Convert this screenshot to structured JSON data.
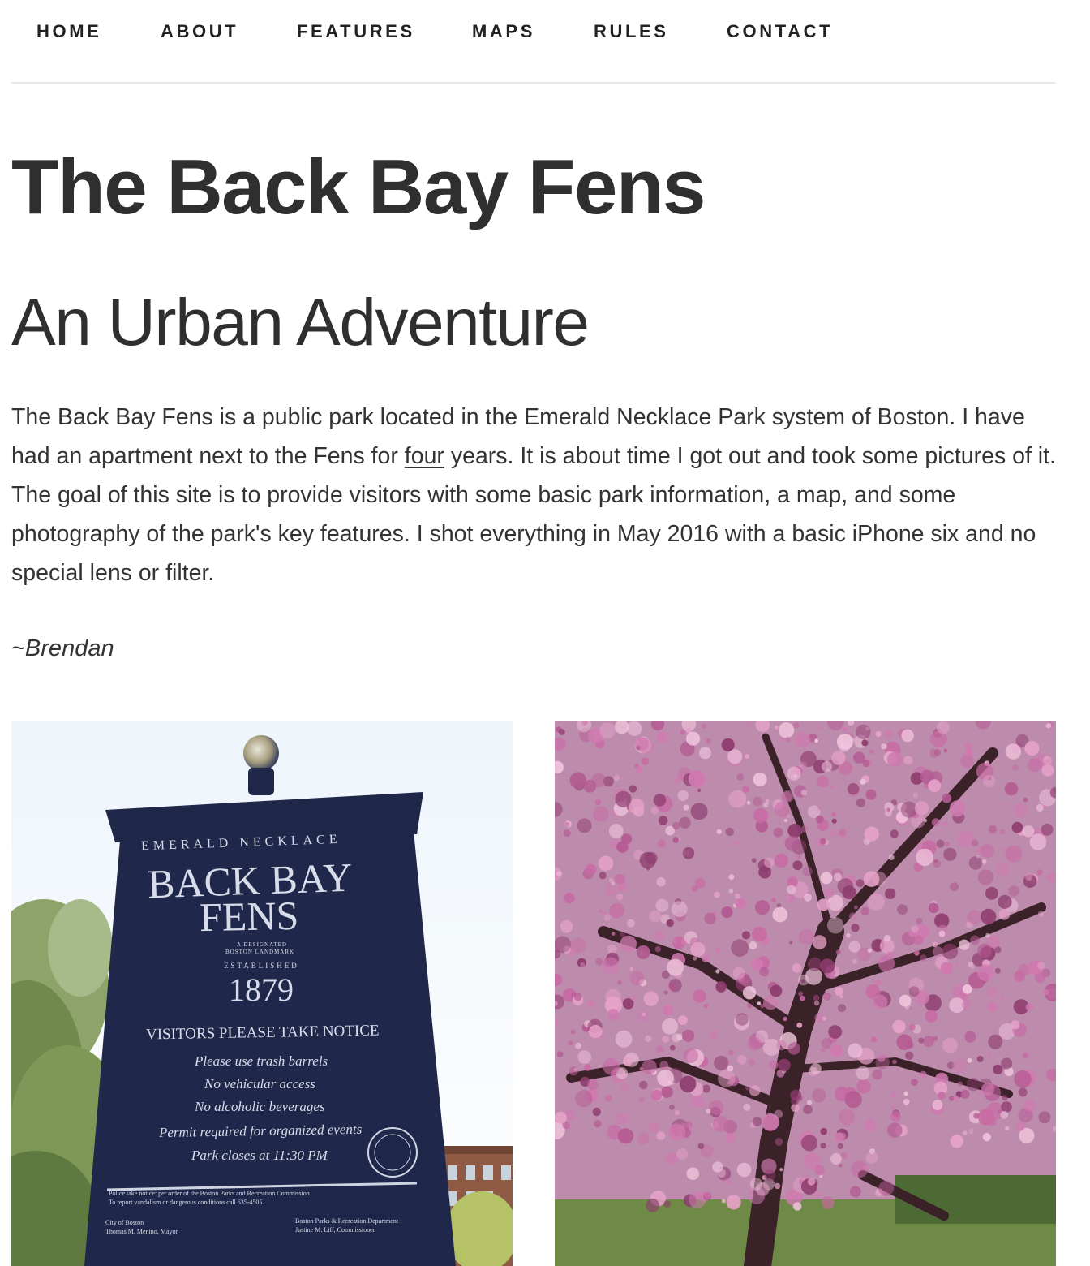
{
  "nav": {
    "items": [
      {
        "label": "HOME"
      },
      {
        "label": "ABOUT"
      },
      {
        "label": "FEATURES"
      },
      {
        "label": "MAPS"
      },
      {
        "label": "RULES"
      },
      {
        "label": "CONTACT"
      }
    ]
  },
  "hero": {
    "title": "The Back Bay Fens",
    "subtitle": "An Urban Adventure"
  },
  "intro": {
    "text_before": "The Back Bay Fens is a public park located in the Emerald Necklace Park system of Boston. I have had an apartment next to the Fens for ",
    "link": "four",
    "text_after": " years. It is about time I got out and took some pictures of it. The goal of this site is to provide visitors with some basic park information, a map, and some photography of the park's key features. I shot everything in May 2016 with a basic iPhone six and no special lens or filter.",
    "signature": "~Brendan"
  },
  "photos": {
    "sign": {
      "header": "EMERALD NECKLACE",
      "name_line1": "BACK BAY",
      "name_line2": "FENS",
      "designation_line1": "A DESIGNATED",
      "designation_line2": "BOSTON LANDMARK",
      "established_label": "ESTABLISHED",
      "year": "1879",
      "notice_title": "VISITORS PLEASE TAKE NOTICE",
      "rules": [
        "Please use trash barrels",
        "No vehicular access",
        "No alcoholic beverages",
        "Permit required for organized events",
        "Park closes at 11:30 PM"
      ],
      "police_line1": "Police take notice: per order of the Boston Parks and Recreation Commission.",
      "police_line2": "To report vandalism or dangerous conditions call 635-4505.",
      "city_line1": "City of Boston",
      "city_line2": "Thomas M. Menino, Mayor",
      "dept_line1": "Boston Parks & Recreation Department",
      "dept_line2": "Justine M. Liff, Commissioner"
    }
  },
  "colors": {
    "text": "#333333",
    "sign_blue": "#1e2748",
    "blossom": "#b0568f"
  }
}
